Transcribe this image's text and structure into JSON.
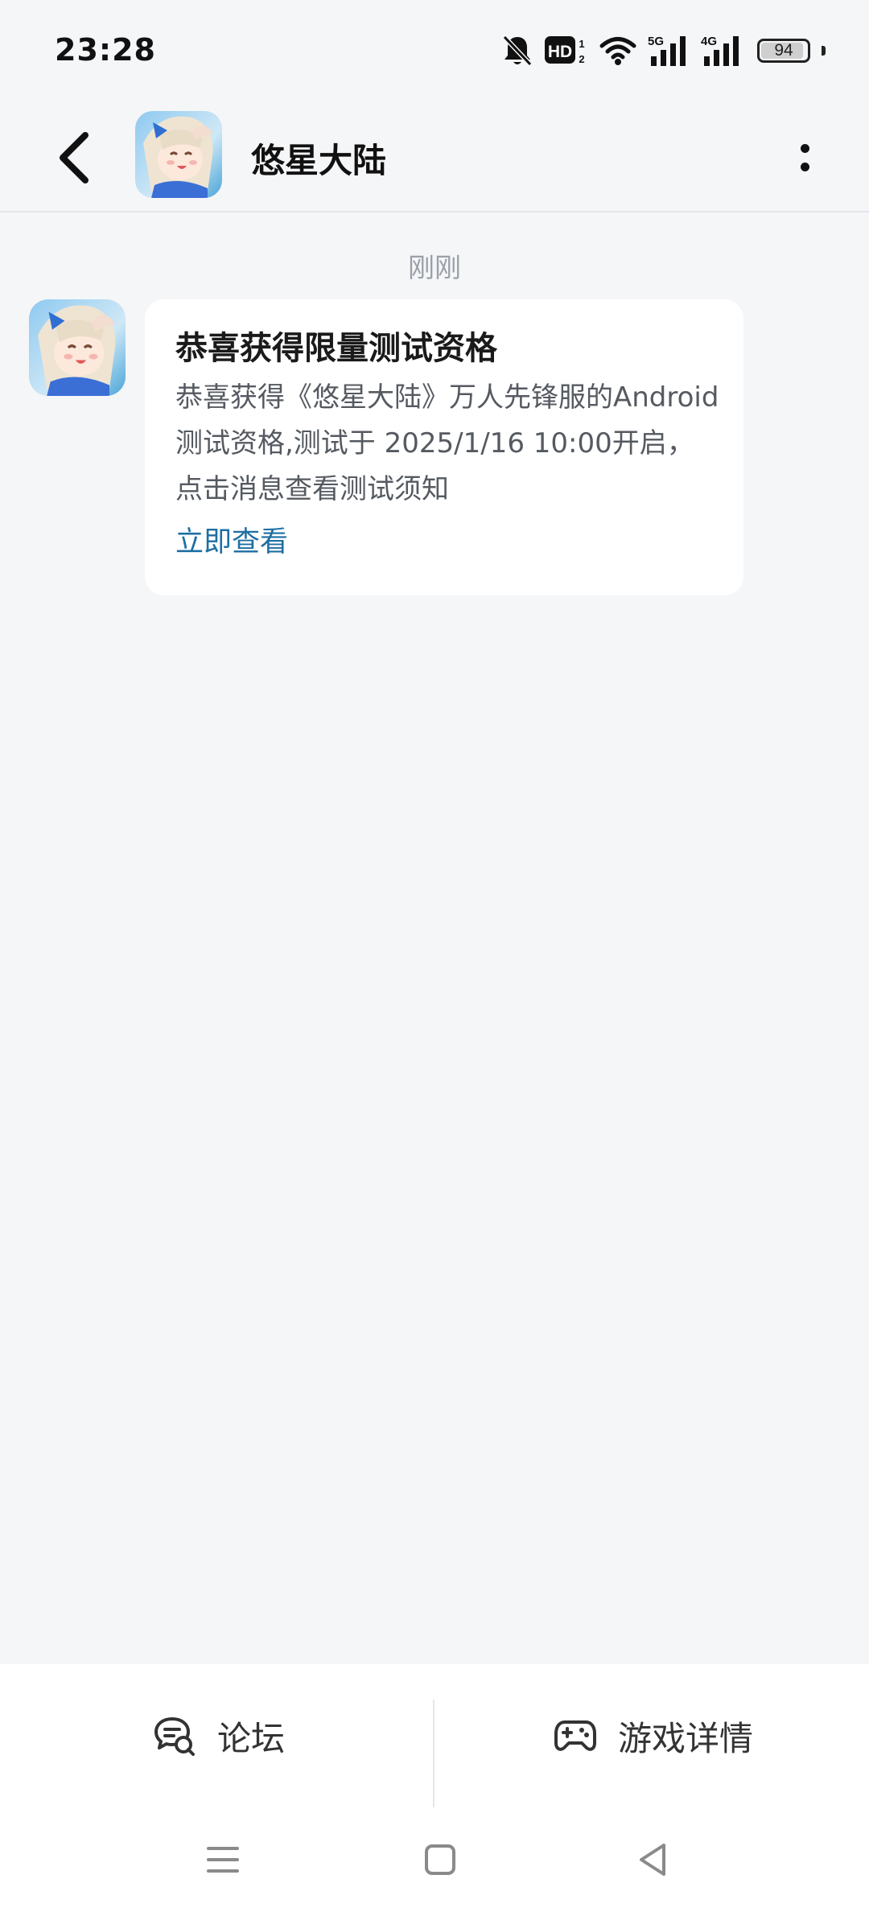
{
  "status_bar": {
    "time": "23:28",
    "battery_level": "94",
    "signal_labels": [
      "5G",
      "4G"
    ],
    "icons": [
      "bell-muted-icon",
      "hd-voice-icon",
      "wifi-icon",
      "signal-5g-icon",
      "signal-4g-icon",
      "battery-icon"
    ]
  },
  "header": {
    "title": "悠星大陆",
    "back_icon": "chevron-left-icon",
    "more_icon": "more-vertical-icon",
    "avatar": "game-avatar"
  },
  "conversation": {
    "timestamp": "刚刚",
    "message": {
      "title": "恭喜获得限量测试资格",
      "body": "恭喜获得《悠星大陆》万人先锋服的Android测试资格,测试于 2025/1/16 10:00开启，点击消息查看测试须知",
      "link": "立即查看"
    }
  },
  "bottom_bar": {
    "tabs": [
      {
        "label": "论坛",
        "icon": "forum-chat-icon"
      },
      {
        "label": "游戏详情",
        "icon": "gamepad-icon"
      }
    ]
  },
  "nav_bar": {
    "icons": [
      "menu-icon",
      "home-square-icon",
      "back-triangle-icon"
    ]
  },
  "colors": {
    "background": "#f5f6f8",
    "card": "#ffffff",
    "link": "#1e6fa3",
    "timestamp": "#9aa0a8"
  }
}
